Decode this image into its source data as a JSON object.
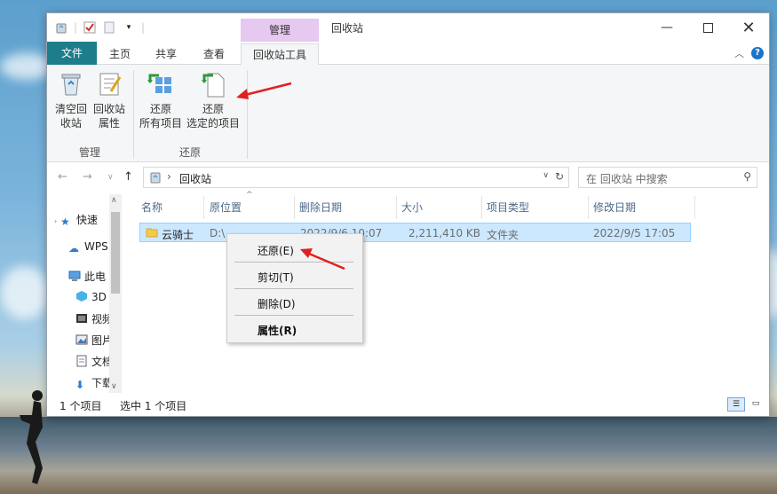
{
  "title_bar": {
    "context_tab": "管理",
    "window_title": "回收站"
  },
  "tabs": [
    "文件",
    "主页",
    "共享",
    "查看",
    "回收站工具"
  ],
  "ribbon": {
    "buttons": [
      {
        "line1": "清空回",
        "line2": "收站"
      },
      {
        "line1": "回收站",
        "line2": "属性"
      },
      {
        "line1": "还原",
        "line2": "所有项目"
      },
      {
        "line1": "还原",
        "line2": "选定的项目"
      }
    ],
    "groups": [
      "管理",
      "还原"
    ]
  },
  "address": {
    "path": "回收站",
    "search_placeholder": "在 回收站 中搜索"
  },
  "nav": {
    "items": [
      "快速",
      "WPS",
      "此电",
      "3D",
      "视频",
      "图片",
      "文档",
      "下载"
    ]
  },
  "columns": [
    "名称",
    "原位置",
    "删除日期",
    "大小",
    "项目类型",
    "修改日期"
  ],
  "rows": [
    {
      "name": "云骑士",
      "location": "D:\\",
      "deleted": "2022/9/6 10:07",
      "size": "2,211,410 KB",
      "type": "文件夹",
      "modified": "2022/9/5 17:05"
    }
  ],
  "status": {
    "count": "1 个项目",
    "selected": "选中 1 个项目"
  },
  "context_menu": {
    "restore": "还原(E)",
    "cut": "剪切(T)",
    "delete": "删除(D)",
    "properties": "属性(R)"
  },
  "colors": {
    "file_tab": "#1e7d8a",
    "manage_tab": "#e6c8f0",
    "selection": "#cce8ff",
    "arrow": "#e02020"
  }
}
